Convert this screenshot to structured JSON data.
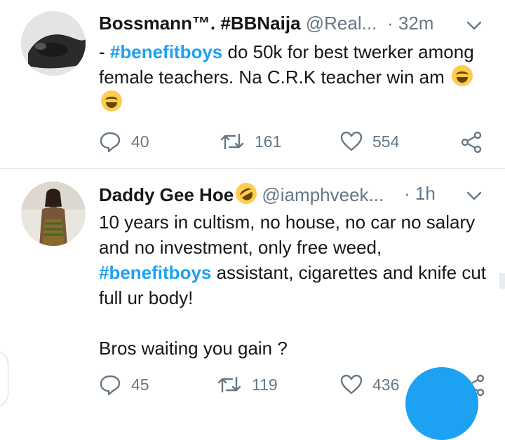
{
  "tweets": [
    {
      "name": "Bossmann™. #BBNaija",
      "handle": "@Real...",
      "time": "· 32m",
      "text_prefix": "- ",
      "hashtag": "#benefitboys",
      "text_after": " do 50k for best twerker among female teachers. Na C.R.K teacher win am",
      "emoji": "face-with-tears-of-joy",
      "replies": "40",
      "retweets": "161",
      "likes": "554"
    },
    {
      "name": "Daddy Gee Hoe",
      "name_emoji": "rolling-on-floor-laughing",
      "handle": "@iamphveek...",
      "time": "· 1h",
      "line1": "10 years in cultism, no house, no car no salary and no investment, only free weed,",
      "hashtag": "#benefitboys",
      "line2": " assistant, cigarettes and knife cut full ur body!",
      "line3": "Bros waiting you gain ?",
      "replies": "45",
      "retweets": "119",
      "likes": "436"
    }
  ],
  "colors": {
    "accent": "#1da1f2",
    "muted": "#657786",
    "divider": "#e1e8ed",
    "text": "#14171a"
  }
}
